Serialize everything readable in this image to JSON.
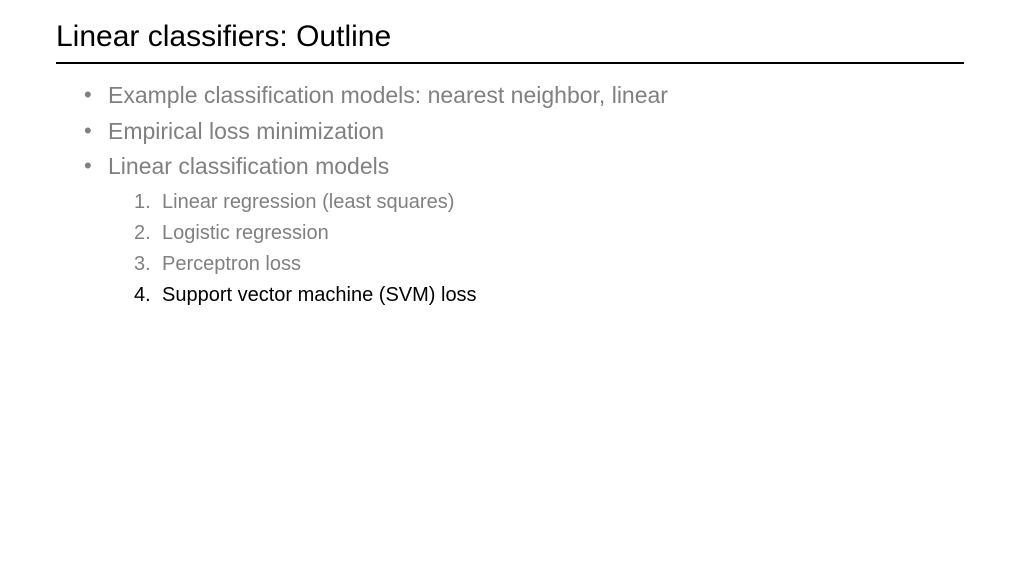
{
  "title": "Linear classifiers: Outline",
  "bullets": {
    "b1": "Example classification models: nearest neighbor, linear",
    "b2": "Empirical loss minimization",
    "b3": "Linear classification models"
  },
  "sub": {
    "s1": "Linear regression (least squares)",
    "s2": "Logistic regression",
    "s3": "Perceptron loss",
    "s4": "Support vector machine (SVM) loss"
  }
}
